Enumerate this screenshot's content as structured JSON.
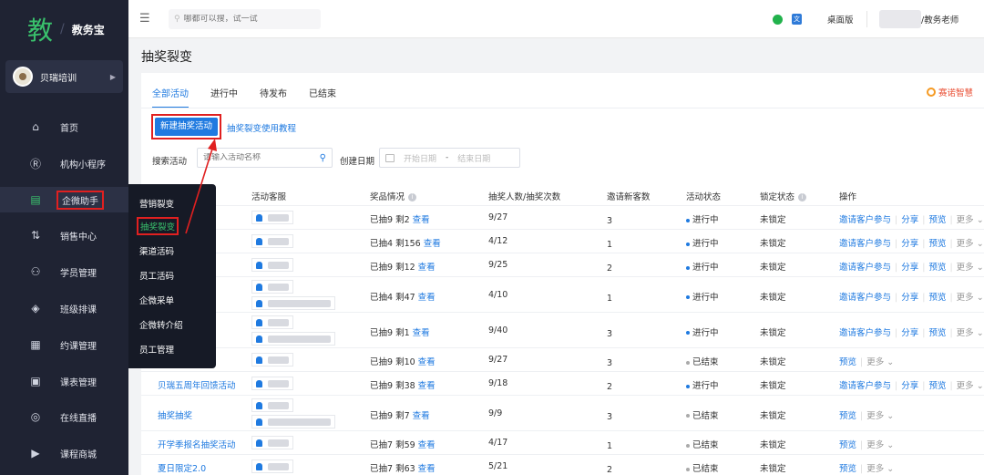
{
  "app": {
    "logo_mark": "教",
    "logo_text": "教务宝"
  },
  "org": {
    "name": "贝瑞培训"
  },
  "sidebar": {
    "items": [
      {
        "label": "首页",
        "icon": "home-icon"
      },
      {
        "label": "机构小程序",
        "icon": "miniprogram-icon"
      },
      {
        "label": "企微助手",
        "icon": "wecom-icon",
        "active": true
      },
      {
        "label": "销售中心",
        "icon": "sales-icon"
      },
      {
        "label": "学员管理",
        "icon": "students-icon"
      },
      {
        "label": "班级排课",
        "icon": "class-icon"
      },
      {
        "label": "约课管理",
        "icon": "booking-icon"
      },
      {
        "label": "课表管理",
        "icon": "calendar-icon"
      },
      {
        "label": "在线直播",
        "icon": "live-icon"
      },
      {
        "label": "课程商城",
        "icon": "shop-icon"
      }
    ]
  },
  "flyout": {
    "items": [
      "营销裂变",
      "抽奖裂变",
      "渠道活码",
      "员工活码",
      "企微采单",
      "企微转介绍",
      "员工管理"
    ],
    "active_index": 1
  },
  "topbar": {
    "search_placeholder": "哪都可以搜，试一试",
    "desktop_label": "桌面版",
    "user_role": "/教务老师"
  },
  "page": {
    "title": "抽奖裂变"
  },
  "tabs": [
    "全部活动",
    "进行中",
    "待发布",
    "已结束"
  ],
  "help": {
    "label": "赛诺智慧"
  },
  "actions": {
    "new_button": "新建抽奖活动",
    "tutorial_link": "抽奖裂变使用教程"
  },
  "filters": {
    "search_label": "搜索活动",
    "search_placeholder": "请输入活动名称",
    "date_label": "创建日期",
    "start_placeholder": "开始日期",
    "end_placeholder": "结束日期",
    "separator": "-"
  },
  "table": {
    "columns": [
      "活动客服",
      "奖品情况",
      "抽奖人数/抽奖次数",
      "邀请新客数",
      "活动状态",
      "锁定状态",
      "操作"
    ],
    "look_label": "查看",
    "ops": {
      "invite": "邀请客户参与",
      "share": "分享",
      "preview": "预览",
      "more": "更多"
    },
    "rows": [
      {
        "name": "",
        "staff": 1,
        "prize": "已抽9 剩2",
        "draws": "9/27",
        "new": "3",
        "status": "进行中",
        "lock": "未锁定",
        "ops": "full"
      },
      {
        "name": "",
        "staff": 1,
        "prize": "已抽4 剩156",
        "draws": "4/12",
        "new": "1",
        "status": "进行中",
        "lock": "未锁定",
        "ops": "full"
      },
      {
        "name": "",
        "staff": 1,
        "prize": "已抽9 剩12",
        "draws": "9/25",
        "new": "2",
        "status": "进行中",
        "lock": "未锁定",
        "ops": "full"
      },
      {
        "name": "",
        "staff": 2,
        "prize": "已抽4 剩47",
        "draws": "4/10",
        "new": "1",
        "status": "进行中",
        "lock": "未锁定",
        "ops": "full"
      },
      {
        "name": "",
        "staff": 2,
        "prize": "已抽9 剩1",
        "draws": "9/40",
        "new": "3",
        "status": "进行中",
        "lock": "未锁定",
        "ops": "full"
      },
      {
        "name": "",
        "staff": 1,
        "prize": "已抽9 剩10",
        "draws": "9/27",
        "new": "3",
        "status": "已结束",
        "lock": "未锁定",
        "ops": "short"
      },
      {
        "name": "贝瑞五周年回馈活动",
        "staff": 1,
        "prize": "已抽9 剩38",
        "draws": "9/18",
        "new": "2",
        "status": "进行中",
        "lock": "未锁定",
        "ops": "full"
      },
      {
        "name": "抽奖抽奖",
        "staff": 2,
        "prize": "已抽9 剩7",
        "draws": "9/9",
        "new": "3",
        "status": "已结束",
        "lock": "未锁定",
        "ops": "short"
      },
      {
        "name": "开学季报名抽奖活动",
        "staff": 1,
        "prize": "已抽7 剩59",
        "draws": "4/17",
        "new": "1",
        "status": "已结束",
        "lock": "未锁定",
        "ops": "short"
      },
      {
        "name": "夏日限定2.0",
        "staff": 1,
        "prize": "已抽7 剩63",
        "draws": "5/21",
        "new": "2",
        "status": "已结束",
        "lock": "未锁定",
        "ops": "short"
      }
    ]
  }
}
